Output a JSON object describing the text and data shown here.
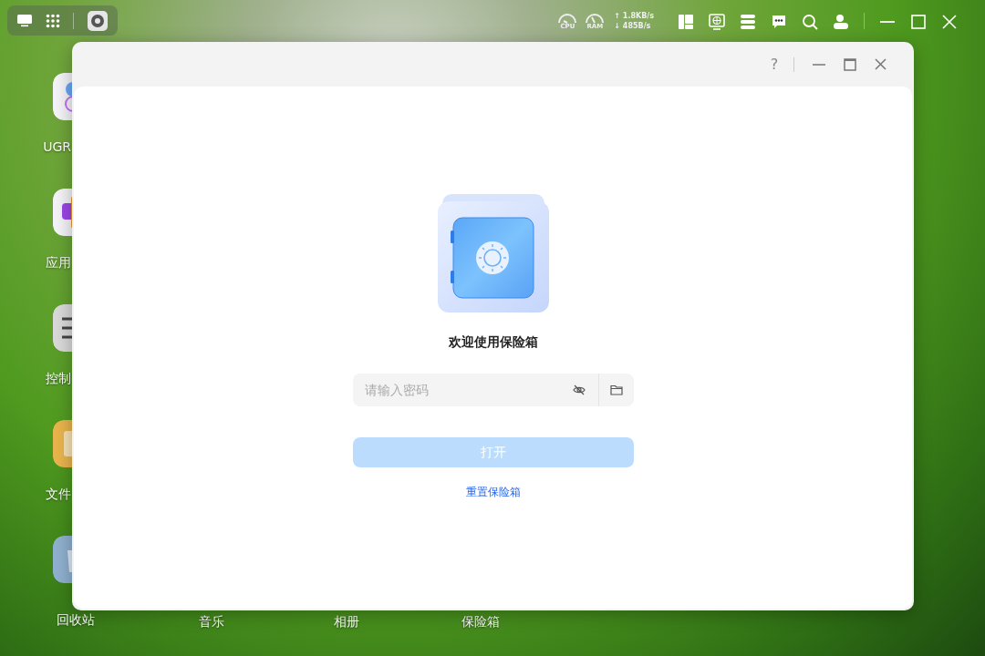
{
  "topbar": {
    "cpu_label": "CPU",
    "ram_label": "RAM",
    "upload_arrow": "↑",
    "upload": "1.8KB/s",
    "download_arrow": "↓",
    "download": "485B/s"
  },
  "desktop_icons": [
    {
      "kind": "people",
      "label": "UGR"
    },
    {
      "kind": "apps",
      "label": "应用"
    },
    {
      "kind": "control",
      "label": "控制"
    },
    {
      "kind": "folder",
      "label": "文件"
    },
    {
      "kind": "trash",
      "label": "回收站"
    }
  ],
  "desktop_bottom_labels": [
    "音乐",
    "相册",
    "保险箱"
  ],
  "window": {
    "help": "?"
  },
  "vault": {
    "title": "欢迎使用保险箱",
    "password": {
      "placeholder": "请输入密码"
    },
    "open_button": {
      "label": "打开",
      "disabled": true
    },
    "reset_link": "重置保险箱"
  }
}
